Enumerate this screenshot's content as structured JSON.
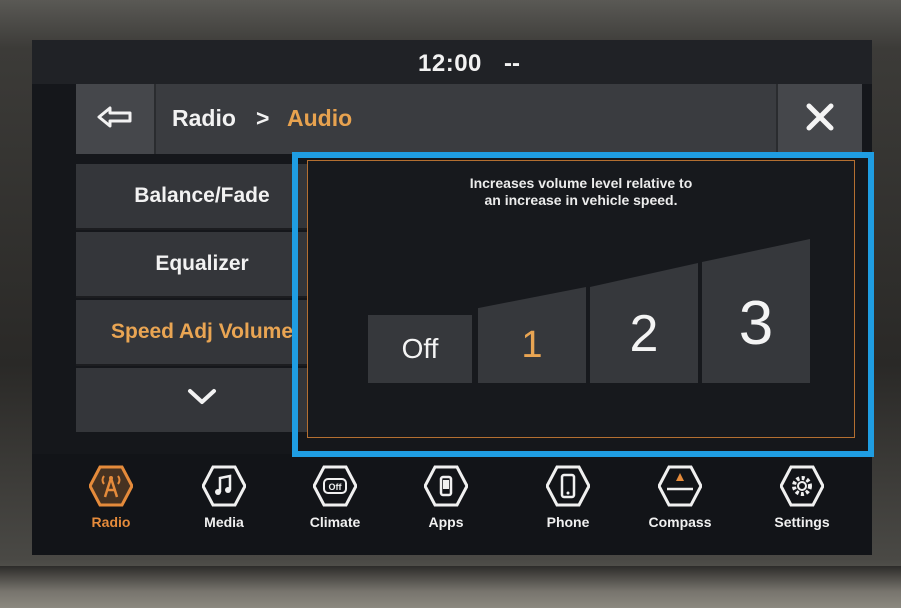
{
  "status_bar": {
    "time": "12:00",
    "indicator": "--"
  },
  "header": {
    "back_icon": "back-arrow-icon",
    "breadcrumb_root": "Radio",
    "breadcrumb_separator": ">",
    "breadcrumb_current": "Audio",
    "close_icon": "close-icon"
  },
  "menu": {
    "items": [
      {
        "label": "Balance/Fade",
        "active": false
      },
      {
        "label": "Equalizer",
        "active": false
      },
      {
        "label": "Speed Adj Volume",
        "active": true
      }
    ],
    "more_icon": "chevron-down-icon"
  },
  "panel": {
    "description_line1": "Increases volume level relative to",
    "description_line2": "an increase in vehicle speed.",
    "levels": [
      {
        "label": "Off",
        "selected": false
      },
      {
        "label": "1",
        "selected": true
      },
      {
        "label": "2",
        "selected": false
      },
      {
        "label": "3",
        "selected": false
      }
    ]
  },
  "dock": {
    "items": [
      {
        "label": "Radio",
        "icon": "radio-tower-icon",
        "active": true
      },
      {
        "label": "Media",
        "icon": "music-note-icon",
        "active": false
      },
      {
        "label": "Climate",
        "icon": "climate-off-icon",
        "active": false
      },
      {
        "label": "Apps",
        "icon": "apps-icon",
        "active": false
      },
      {
        "label": "Phone",
        "icon": "phone-icon",
        "active": false
      },
      {
        "label": "Compass",
        "icon": "compass-icon",
        "active": false
      },
      {
        "label": "Settings",
        "icon": "gear-icon",
        "active": false
      }
    ]
  },
  "colors": {
    "accent": "#e9a553",
    "highlight_border": "#1f9de2",
    "panel_border": "#b46f31"
  }
}
